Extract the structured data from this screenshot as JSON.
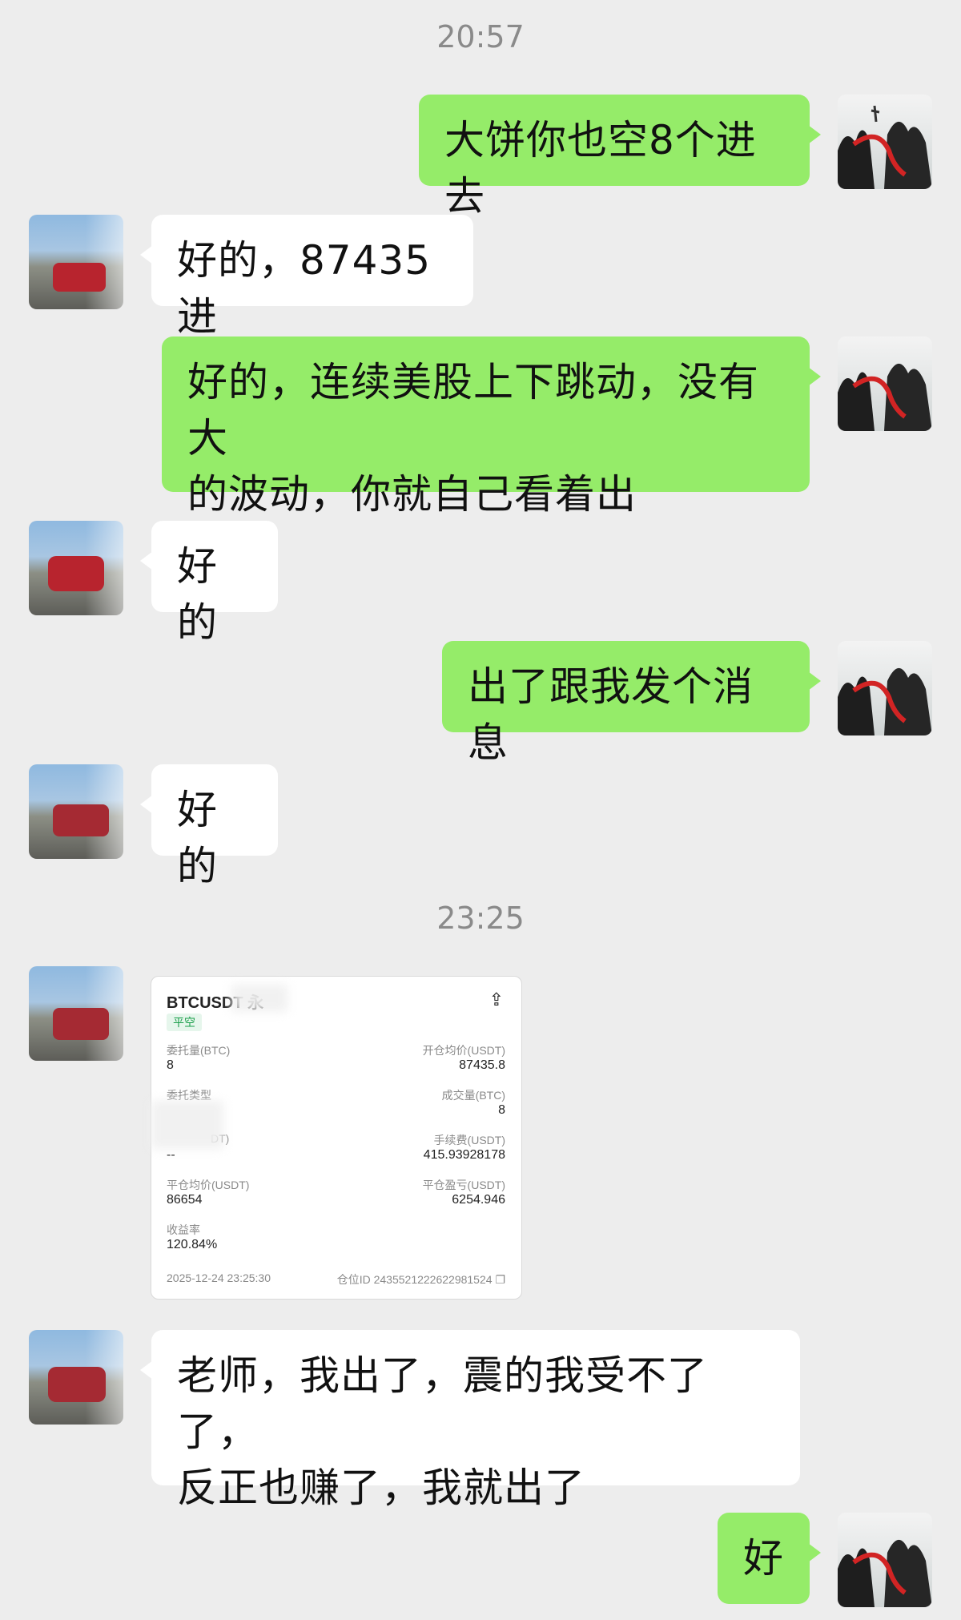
{
  "timestamps": [
    "20:57",
    "23:25"
  ],
  "messages": [
    {
      "from": "me",
      "text": "大饼你也空8个进去"
    },
    {
      "from": "other",
      "text": "好的，87435进"
    },
    {
      "from": "me",
      "line1": "好的，连续美股上下跳动，没有大",
      "line2": "的波动，你就自己看着出"
    },
    {
      "from": "other",
      "text": "好的"
    },
    {
      "from": "me",
      "text": "出了跟我发个消息"
    },
    {
      "from": "other",
      "text": "好的"
    },
    {
      "from": "other",
      "line1": "老师，我出了，震的我受不了了，",
      "line2": "反正也赚了，我就出了"
    },
    {
      "from": "me",
      "text": "好"
    }
  ],
  "trade_card": {
    "symbol": "BTCUSDT 永",
    "share_icon": "share-icon",
    "tag": "平空",
    "order_qty_label": "委托量(BTC)",
    "order_qty": "8",
    "open_avg_label": "开仓均价(USDT)",
    "open_avg": "87435.8",
    "order_type_label": "委托类型",
    "order_type": "",
    "filled_qty_label": "成交量(BTC)",
    "filled_qty": "8",
    "row3_left_label": "DT)",
    "row3_left_value": "--",
    "fee_label": "手续费(USDT)",
    "fee": "415.93928178",
    "close_avg_label": "平仓均价(USDT)",
    "close_avg": "86654",
    "pnl_label": "平仓盈亏(USDT)",
    "pnl": "6254.946",
    "roi_label": "收益率",
    "roi": "120.84%",
    "datetime": "2025-12-24 23:25:30",
    "position_id": "仓位ID 2435521222622981524"
  },
  "colors": {
    "me_bubble": "#95ec69",
    "other_bubble": "#ffffff",
    "background": "#ededed",
    "time": "#8a8a8a"
  }
}
